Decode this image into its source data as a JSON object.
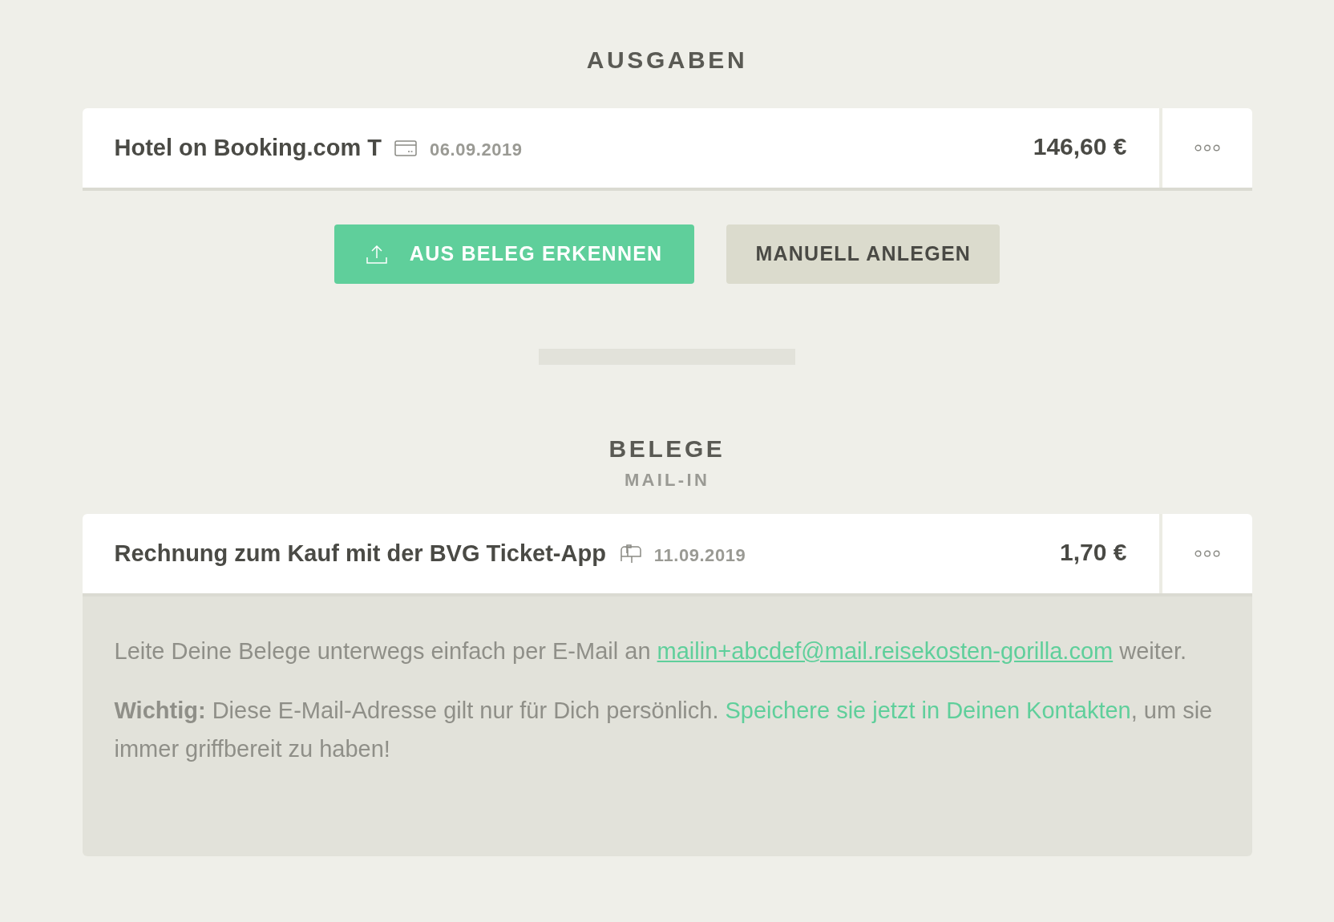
{
  "sections": [
    {
      "title": "AUSGABEN",
      "entries": [
        {
          "title": "Hotel on Booking.com T",
          "kind": "card",
          "date": "06.09.2019",
          "amount": "146,60 €"
        }
      ],
      "buttons": [
        {
          "label": "AUS BELEG ERKENNEN",
          "kind": "primary"
        },
        {
          "label": "MANUELL ANLEGEN",
          "kind": "secondary"
        }
      ]
    },
    {
      "title": "BELEGE",
      "subtitle": "MAIL-IN",
      "entries": [
        {
          "title": "Rechnung zum Kauf mit der BVG Ticket-App",
          "kind": "mail",
          "date": "11.09.2019",
          "amount": "1,70 €"
        }
      ],
      "info": [
        {
          "before": "Leite Deine Belege unterwegs einfach per E-Mail an ",
          "link": "mailin+abcdef@mail.reisekosten-gorilla.com",
          "underlined": true,
          "after": " weiter."
        },
        {
          "before": "**Wichtig:** Diese E-Mail-Adresse gilt nur für Dich persönlich. ",
          "link": "Speichere sie jetzt in Deinen Kontakten",
          "underlined": false,
          "after": ", um sie immer griffbereit zu haben!"
        }
      ]
    }
  ]
}
